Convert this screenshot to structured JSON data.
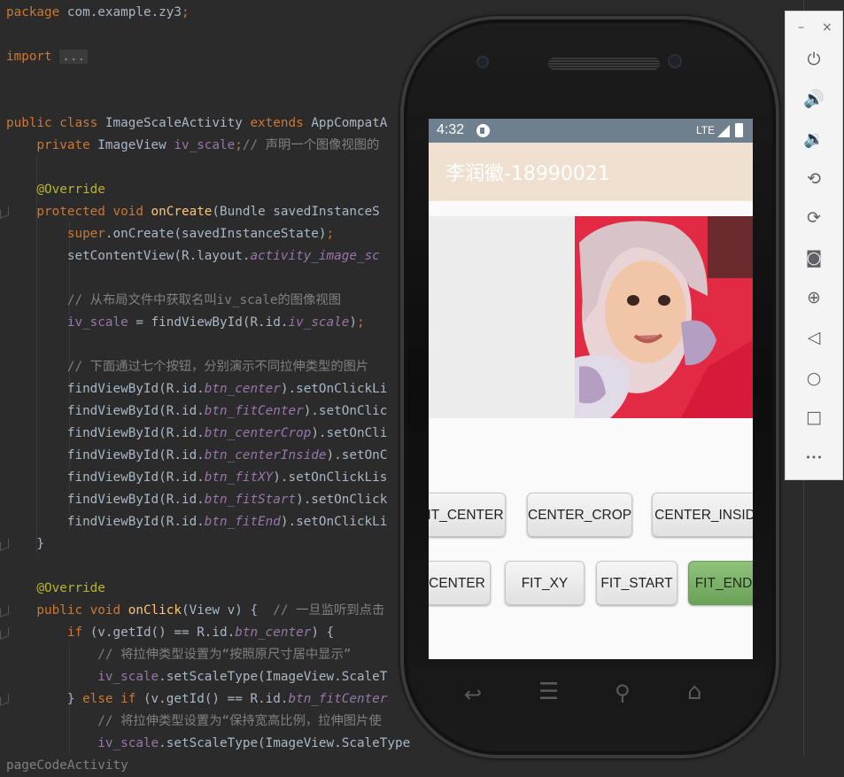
{
  "editor": {
    "lines": [
      {
        "segments": [
          {
            "t": "package ",
            "c": "kw"
          },
          {
            "t": "com.example.zy3",
            "c": ""
          },
          {
            "t": ";",
            "c": "kw"
          }
        ]
      },
      {
        "segments": []
      },
      {
        "segments": [
          {
            "t": "import ",
            "c": "kw"
          },
          {
            "t": "...",
            "c": "fold-box"
          }
        ]
      },
      {
        "segments": []
      },
      {
        "segments": []
      },
      {
        "segments": [
          {
            "t": "public class ",
            "c": "kw"
          },
          {
            "t": "ImageScaleActivity ",
            "c": ""
          },
          {
            "t": "extends ",
            "c": "kw"
          },
          {
            "t": "AppCompatA",
            "c": ""
          }
        ]
      },
      {
        "segments": [
          {
            "t": "    private ",
            "c": "kw"
          },
          {
            "t": "ImageView ",
            "c": ""
          },
          {
            "t": "iv_scale",
            "c": "fld"
          },
          {
            "t": ";",
            "c": "kw"
          },
          {
            "t": "// 声明一个图像视图的",
            "c": "cm"
          }
        ]
      },
      {
        "segments": []
      },
      {
        "segments": [
          {
            "t": "    @Override",
            "c": "ann"
          }
        ]
      },
      {
        "segments": [
          {
            "t": "    protected void ",
            "c": "kw"
          },
          {
            "t": "onCreate",
            "c": "fn"
          },
          {
            "t": "(Bundle savedInstanceS",
            "c": ""
          }
        ]
      },
      {
        "segments": [
          {
            "t": "        super",
            "c": "kw"
          },
          {
            "t": ".onCreate(savedInstanceState)",
            "c": ""
          },
          {
            "t": ";",
            "c": "kw"
          }
        ]
      },
      {
        "segments": [
          {
            "t": "        setContentView(R.layout.",
            "c": ""
          },
          {
            "t": "activity_image_sc",
            "c": "fldi"
          }
        ]
      },
      {
        "segments": []
      },
      {
        "segments": [
          {
            "t": "        // 从布局文件中获取名叫iv_scale的图像视图",
            "c": "cm"
          }
        ]
      },
      {
        "segments": [
          {
            "t": "        iv_scale",
            "c": "fld"
          },
          {
            "t": " = findViewById(R.id.",
            "c": ""
          },
          {
            "t": "iv_scale",
            "c": "fldi"
          },
          {
            "t": ")",
            "c": ""
          },
          {
            "t": ";",
            "c": "kw"
          }
        ]
      },
      {
        "segments": []
      },
      {
        "segments": [
          {
            "t": "        // 下面通过七个按钮，分别演示不同拉伸类型的图片",
            "c": "cm"
          }
        ]
      },
      {
        "segments": [
          {
            "t": "        findViewById(R.id.",
            "c": ""
          },
          {
            "t": "btn_center",
            "c": "fldi"
          },
          {
            "t": ").setOnClickLi",
            "c": ""
          }
        ]
      },
      {
        "segments": [
          {
            "t": "        findViewById(R.id.",
            "c": ""
          },
          {
            "t": "btn_fitCenter",
            "c": "fldi"
          },
          {
            "t": ").setOnClic",
            "c": ""
          }
        ]
      },
      {
        "segments": [
          {
            "t": "        findViewById(R.id.",
            "c": ""
          },
          {
            "t": "btn_centerCrop",
            "c": "fldi"
          },
          {
            "t": ").setOnCli",
            "c": ""
          }
        ]
      },
      {
        "segments": [
          {
            "t": "        findViewById(R.id.",
            "c": ""
          },
          {
            "t": "btn_centerInside",
            "c": "fldi"
          },
          {
            "t": ").setOnC",
            "c": ""
          }
        ]
      },
      {
        "segments": [
          {
            "t": "        findViewById(R.id.",
            "c": ""
          },
          {
            "t": "btn_fitXY",
            "c": "fldi"
          },
          {
            "t": ").setOnClickLis",
            "c": ""
          }
        ]
      },
      {
        "segments": [
          {
            "t": "        findViewById(R.id.",
            "c": ""
          },
          {
            "t": "btn_fitStart",
            "c": "fldi"
          },
          {
            "t": ").setOnClick",
            "c": ""
          }
        ]
      },
      {
        "segments": [
          {
            "t": "        findViewById(R.id.",
            "c": ""
          },
          {
            "t": "btn_fitEnd",
            "c": "fldi"
          },
          {
            "t": ").setOnClickLi",
            "c": ""
          }
        ]
      },
      {
        "segments": [
          {
            "t": "    }",
            "c": ""
          }
        ]
      },
      {
        "segments": []
      },
      {
        "segments": [
          {
            "t": "    @Override",
            "c": "ann"
          }
        ]
      },
      {
        "segments": [
          {
            "t": "    public void ",
            "c": "kw"
          },
          {
            "t": "onClick",
            "c": "fn"
          },
          {
            "t": "(View v) {  ",
            "c": ""
          },
          {
            "t": "// 一旦监听到点击",
            "c": "cm"
          }
        ]
      },
      {
        "segments": [
          {
            "t": "        if ",
            "c": "kw"
          },
          {
            "t": "(v.getId() == R.id.",
            "c": ""
          },
          {
            "t": "btn_center",
            "c": "fldi"
          },
          {
            "t": ") {",
            "c": ""
          }
        ]
      },
      {
        "segments": [
          {
            "t": "            // 将拉伸类型设置为“按照原尺寸居中显示”",
            "c": "cm"
          }
        ]
      },
      {
        "segments": [
          {
            "t": "            iv_scale",
            "c": "fld"
          },
          {
            "t": ".setScaleType(ImageView.ScaleT",
            "c": ""
          }
        ]
      },
      {
        "segments": [
          {
            "t": "        } ",
            "c": ""
          },
          {
            "t": "else if ",
            "c": "kw"
          },
          {
            "t": "(v.getId() == R.id.",
            "c": ""
          },
          {
            "t": "btn_fitCenter",
            "c": "fldi"
          }
        ]
      },
      {
        "segments": [
          {
            "t": "            // 将拉伸类型设置为“保持宽高比例，拉伸图片使",
            "c": "cm"
          }
        ]
      },
      {
        "segments": [
          {
            "t": "            iv_scale",
            "c": "fld"
          },
          {
            "t": ".setScaleType(ImageView.ScaleType",
            "c": ""
          }
        ]
      },
      {
        "segments": [
          {
            "t": "pageCodeActivity",
            "c": "cm"
          }
        ]
      }
    ]
  },
  "phone": {
    "status": {
      "time": "4:32",
      "network": "LTE"
    },
    "app_title": "李润徽-18990021",
    "buttons_row1": [
      "IT_CENTER",
      "CENTER_CROP",
      "CENTER_INSID"
    ],
    "buttons_row2": [
      "CENTER",
      "FIT_XY",
      "FIT_START",
      "FIT_END"
    ],
    "nav_icons": [
      "back-icon",
      "menu-icon",
      "search-icon",
      "home-icon"
    ]
  },
  "toolbar": {
    "minimize": "–",
    "close": "×",
    "icons": [
      "power-icon",
      "volume-up-icon",
      "volume-down-icon",
      "rotate-left-icon",
      "rotate-right-icon",
      "camera-icon",
      "zoom-icon",
      "back-icon",
      "home-icon",
      "overview-icon",
      "more-icon"
    ],
    "glyphs": [
      "⏻",
      "🔊",
      "🔉",
      "⟲",
      "⟳",
      "◙",
      "⊕",
      "◁",
      "○",
      "□",
      "•••"
    ]
  },
  "colors": {
    "editor_bg": "#2b2b2b",
    "keyword": "#cc7832",
    "annotation": "#bbb529",
    "field": "#9876aa",
    "function": "#ffc66d",
    "comment": "#808080",
    "statusbar": "#6e7f8d",
    "appbar": "#efe0d0",
    "fit_end_button": "#7bb267"
  }
}
